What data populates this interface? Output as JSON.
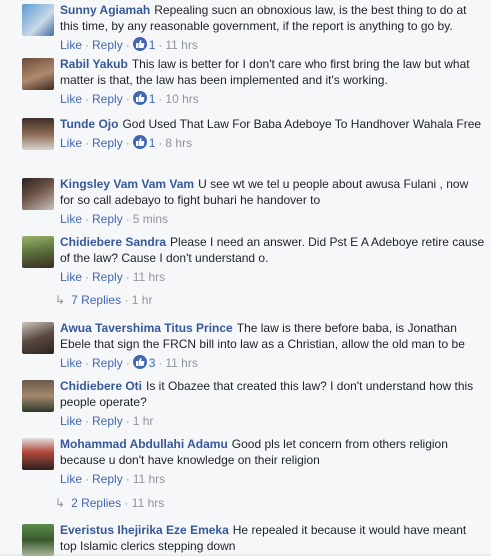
{
  "actions": {
    "like": "Like",
    "reply": "Reply",
    "sep": "·"
  },
  "comments": [
    {
      "author": "Sunny Agiamah",
      "text": "Repealing sucn an obnoxious law, is the best thing to do at this time, by any reasonable government, if the report is anything to go by.",
      "likes": "1",
      "time": "11 hrs"
    },
    {
      "author": "Rabil Yakub",
      "text": "This law is better for I don't care who first bring the law but what matter is that, the law has been implemented and it's working.",
      "likes": "1",
      "time": "10 hrs"
    },
    {
      "author": "Tunde Ojo",
      "text": "God Used That Law For Baba Adeboye To Handhover Wahala Free",
      "likes": "1",
      "time": "8 hrs"
    },
    {
      "author": "Kingsley Vam Vam Vam",
      "text": "U see wt we tel u people about awusa Fulani , now for so call adebayo to fight buhari he handover to",
      "likes": "",
      "time": "5 mins"
    },
    {
      "author": "Chidiebere Sandra",
      "text": "Please I need an answer. Did Pst E A Adeboye retire cause of the law? Cause I don't understand o.",
      "likes": "",
      "time": "11 hrs"
    },
    {
      "author": "Awua Tavershima Titus Prince",
      "text": "The law is there before baba, is Jonathan Ebele that sign the FRCN bill into law as a Christian, allow the old man to be",
      "likes": "3",
      "time": "11 hrs"
    },
    {
      "author": "Chidiebere Oti",
      "text": "Is it Obazee that created this law? I don't understand how this people operate?",
      "likes": "",
      "time": "1 hr"
    },
    {
      "author": "Mohammad Abdullahi Adamu",
      "text": "Good pls let concern from others religion because u don't have knowledge on their religion",
      "likes": "",
      "time": "11 hrs"
    },
    {
      "author": "Everistus Ihejirika Eze Emeka",
      "text": "He repealed it because it would have meant top Islamic clerics stepping down",
      "likes": "",
      "time": ""
    }
  ],
  "reply_threads": [
    {
      "arrow": "↳",
      "label": "7 Replies",
      "time": "1 hr"
    },
    {
      "arrow": "↳",
      "label": "2 Replies",
      "time": "11 hrs"
    }
  ],
  "colors": {
    "link": "#4267b2",
    "author": "#365899",
    "meta": "#90949c",
    "background": "#f6f7f9"
  }
}
